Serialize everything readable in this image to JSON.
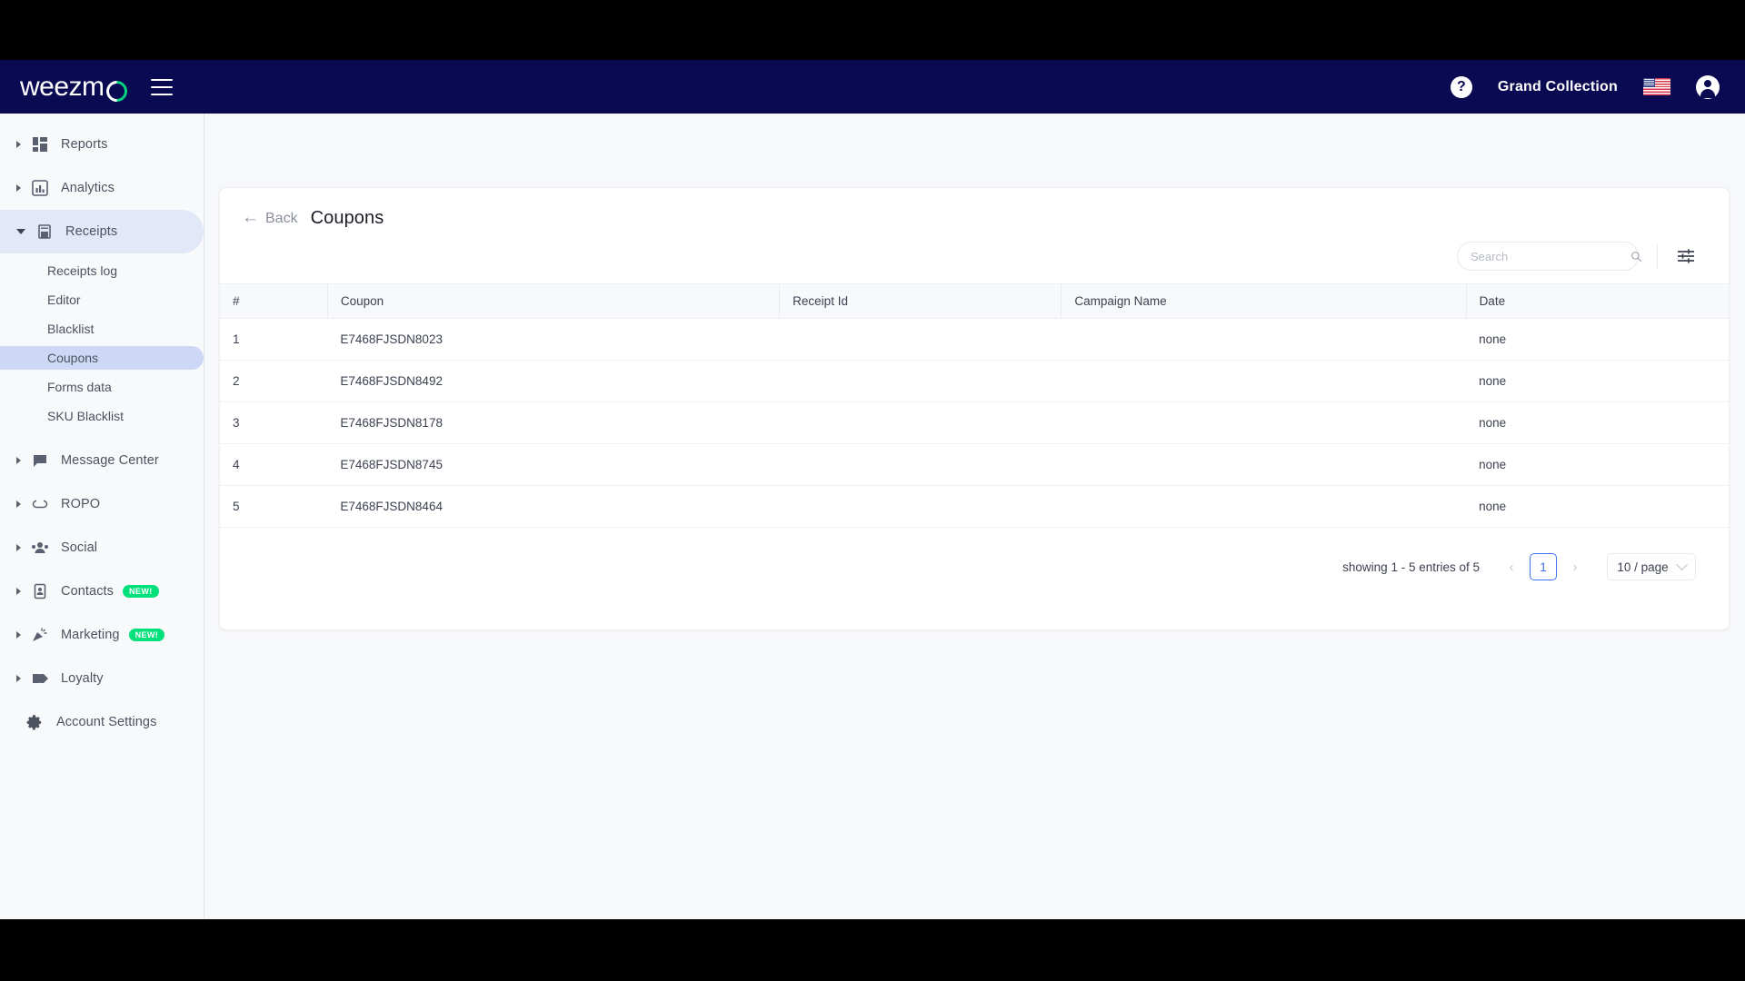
{
  "topbar": {
    "logo_text": "weezm",
    "org_name": "Grand Collection",
    "help_label": "?",
    "flag_alt": "us-flag"
  },
  "sidebar": {
    "items": [
      {
        "label": "Reports",
        "icon": "grid-icon",
        "expandable": true,
        "badge": null
      },
      {
        "label": "Analytics",
        "icon": "bar-chart-icon",
        "expandable": true,
        "badge": null
      },
      {
        "label": "Receipts",
        "icon": "receipt-icon",
        "expandable": true,
        "badge": null,
        "expanded": true
      },
      {
        "label": "Message Center",
        "icon": "chat-icon",
        "expandable": true,
        "badge": null
      },
      {
        "label": "ROPO",
        "icon": "infinity-icon",
        "expandable": true,
        "badge": null
      },
      {
        "label": "Social",
        "icon": "people-icon",
        "expandable": true,
        "badge": null
      },
      {
        "label": "Contacts",
        "icon": "contact-book-icon",
        "expandable": true,
        "badge": "NEW!"
      },
      {
        "label": "Marketing",
        "icon": "megaphone-icon",
        "expandable": true,
        "badge": "NEW!"
      },
      {
        "label": "Loyalty",
        "icon": "tag-icon",
        "expandable": true,
        "badge": null
      },
      {
        "label": "Account Settings",
        "icon": "gear-icon",
        "expandable": false,
        "badge": null
      }
    ],
    "receipts_children": [
      {
        "label": "Receipts log",
        "active": false
      },
      {
        "label": "Editor",
        "active": false
      },
      {
        "label": "Blacklist",
        "active": false
      },
      {
        "label": "Coupons",
        "active": true
      },
      {
        "label": "Forms data",
        "active": false
      },
      {
        "label": "SKU Blacklist",
        "active": false
      }
    ]
  },
  "page": {
    "back_label": "Back",
    "title": "Coupons"
  },
  "search": {
    "placeholder": "Search",
    "value": ""
  },
  "table": {
    "columns": [
      "#",
      "Coupon",
      "Receipt Id",
      "Campaign Name",
      "Date"
    ],
    "rows": [
      {
        "index": "1",
        "coupon": "E7468FJSDN8023",
        "receipt_id": "",
        "campaign_name": "",
        "date": "none"
      },
      {
        "index": "2",
        "coupon": "E7468FJSDN8492",
        "receipt_id": "",
        "campaign_name": "",
        "date": "none"
      },
      {
        "index": "3",
        "coupon": "E7468FJSDN8178",
        "receipt_id": "",
        "campaign_name": "",
        "date": "none"
      },
      {
        "index": "4",
        "coupon": "E7468FJSDN8745",
        "receipt_id": "",
        "campaign_name": "",
        "date": "none"
      },
      {
        "index": "5",
        "coupon": "E7468FJSDN8464",
        "receipt_id": "",
        "campaign_name": "",
        "date": "none"
      }
    ]
  },
  "pagination": {
    "info": "showing 1 - 5 entries of 5",
    "prev_label": "‹",
    "current_page": "1",
    "next_label": "›",
    "per_page": "10 / page"
  },
  "colors": {
    "topbar_bg": "#0a0a52",
    "accent_green": "#00e07b",
    "link_blue": "#3f74f0",
    "sidebar_active": "#ccd8f5",
    "sidebar_expanded": "#e2e8f8"
  }
}
